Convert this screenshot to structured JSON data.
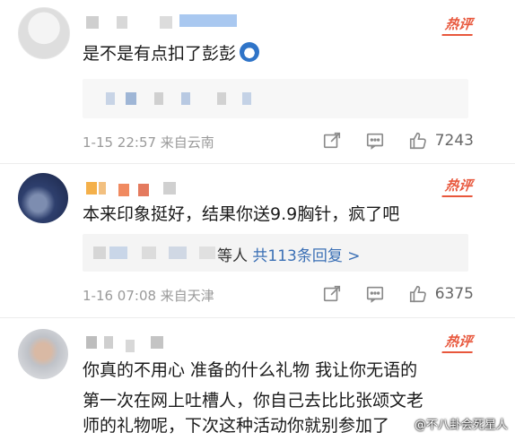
{
  "comments": [
    {
      "text": "是不是有点扣了彭彭",
      "emoji_icon": "doraemon-emoji",
      "badge": "热评",
      "meta": "1-15 22:57 来自云南",
      "likes": "7243"
    },
    {
      "text": "本来印象挺好，结果你送9.9胸针，疯了吧",
      "badge": "热评",
      "replies_suffix": "等人",
      "replies_link": "共113条回复 >",
      "meta": "1-16 07:08 来自天津",
      "likes": "6375"
    },
    {
      "lines": [
        "你真的不用心 准备的什么礼物 我让你无语的",
        "第一次在网上吐槽人，你自己去比比张颂文老",
        "师的礼物呢，下次这种活动你就别参加了"
      ],
      "badge": "热评"
    }
  ],
  "watermark": "@不八卦会死星人",
  "colors": {
    "hot": "#e8573c",
    "link": "#3a6fb5",
    "meta": "#9a9a9a"
  }
}
